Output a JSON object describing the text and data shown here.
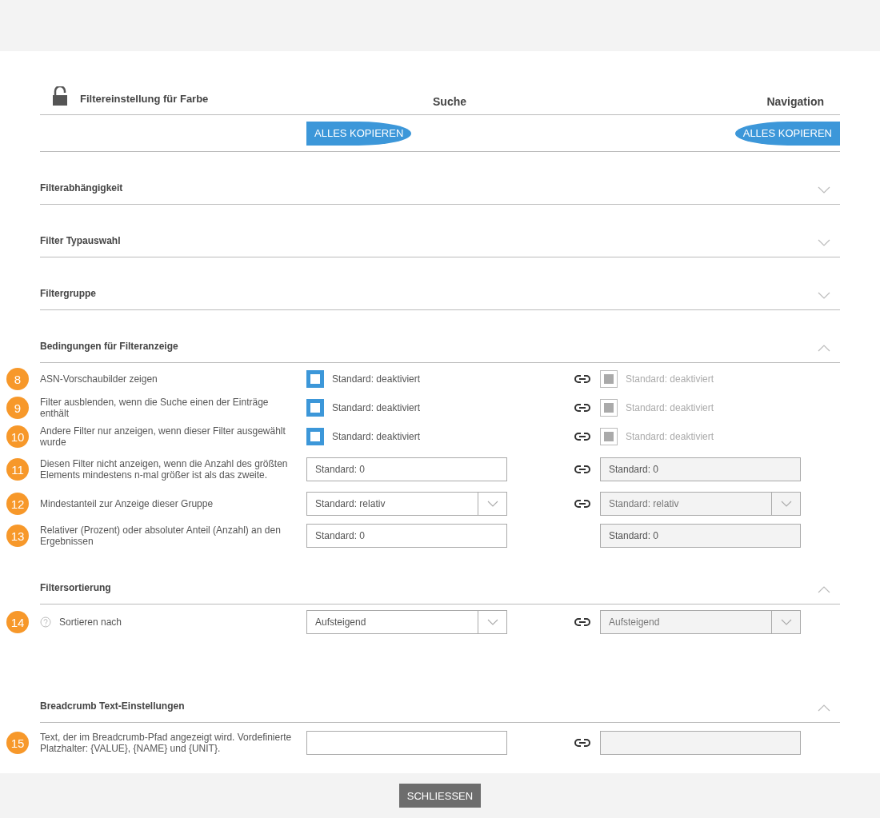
{
  "header": {
    "title": "Filtereinstellung für Farbe",
    "columns": [
      "Suche",
      "Navigation"
    ],
    "copy_buttons": [
      "ALLES KOPIEREN",
      "ALLES KOPIEREN"
    ]
  },
  "sections": [
    {
      "title": "Filterabhängigkeit",
      "expanded": false
    },
    {
      "title": "Filter Typauswahl",
      "expanded": false
    },
    {
      "title": "Filtergruppe",
      "expanded": false
    },
    {
      "title": "Bedingungen für Filteranzeige",
      "expanded": true,
      "rows": [
        {
          "number": "8",
          "label": "ASN-Vorschaubilder zeigen",
          "kind": "checkbox",
          "linked": true,
          "search": {
            "checked": false,
            "text": "Standard: deaktiviert"
          },
          "navigation": {
            "checked": true,
            "text": "Standard: deaktiviert"
          }
        },
        {
          "number": "9",
          "label": "Filter ausblenden, wenn die Suche einen der Einträge enthält",
          "kind": "checkbox",
          "linked": true,
          "search": {
            "checked": false,
            "text": "Standard: deaktiviert"
          },
          "navigation": {
            "checked": true,
            "text": "Standard: deaktiviert"
          }
        },
        {
          "number": "10",
          "label": "Andere Filter nur anzeigen, wenn dieser Filter ausgewählt wurde",
          "kind": "checkbox",
          "linked": true,
          "search": {
            "checked": false,
            "text": "Standard: deaktiviert"
          },
          "navigation": {
            "checked": true,
            "text": "Standard: deaktiviert"
          }
        },
        {
          "number": "11",
          "label": "Diesen Filter nicht anzeigen, wenn die Anzahl des größten Elements mindestens n-mal größer ist als das zweite.",
          "kind": "text",
          "linked": true,
          "search": {
            "placeholder": "Standard: 0"
          },
          "navigation": {
            "placeholder": "Standard: 0"
          }
        },
        {
          "number": "12",
          "label": "Mindestanteil zur Anzeige dieser Gruppe",
          "kind": "select",
          "linked": true,
          "search": {
            "value": "Standard: relativ"
          },
          "navigation": {
            "value": "Standard: relativ"
          }
        },
        {
          "number": "13",
          "label": "Relativer (Prozent) oder absoluter Anteil (Anzahl) an den Ergebnissen",
          "kind": "text",
          "linked": false,
          "search": {
            "placeholder": "Standard: 0"
          },
          "navigation": {
            "placeholder": "Standard: 0"
          }
        }
      ]
    },
    {
      "title": "Filtersortierung",
      "expanded": true,
      "rows": [
        {
          "number": "14",
          "label": "Sortieren nach",
          "help": true,
          "kind": "select",
          "linked": true,
          "search": {
            "value": "Aufsteigend"
          },
          "navigation": {
            "value": "Aufsteigend"
          }
        }
      ]
    },
    {
      "title": "Breadcrumb Text-Einstellungen",
      "expanded": true,
      "rows": [
        {
          "number": "15",
          "label": "Text, der im Breadcrumb-Pfad angezeigt wird. Vordefinierte Platzhalter: {VALUE}, {NAME} und {UNIT}.",
          "kind": "text",
          "linked": true,
          "search": {},
          "navigation": {}
        }
      ]
    }
  ],
  "footer": {
    "button": "SCHLIESSEN"
  }
}
